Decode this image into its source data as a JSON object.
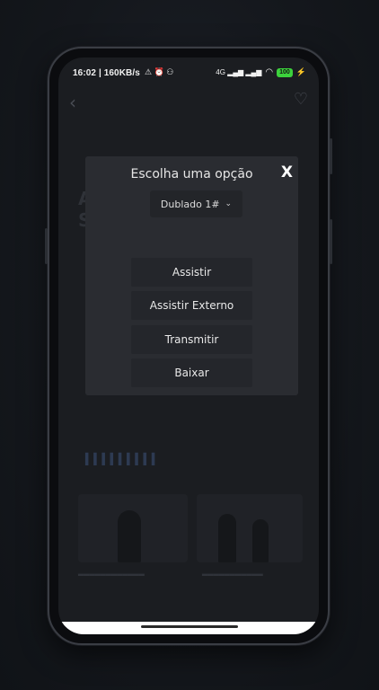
{
  "status_bar": {
    "time": "16:02 | 160KB/s",
    "indicators": "⚠ ⏰ ⚇",
    "network": "4G ▂▄▆ ▂▄▆",
    "battery": "100"
  },
  "dialog": {
    "title": "Escolha uma opção",
    "close_label": "X",
    "select_value": "Dublado 1#",
    "buttons": [
      "Assistir",
      "Assistir Externo",
      "Transmitir",
      "Baixar"
    ]
  },
  "colors": {
    "background": "#14171c",
    "dialog": "#2a2c31",
    "button": "#24262b",
    "battery": "#3cd23c"
  },
  "icons": [
    "back-arrow-icon",
    "heart-icon",
    "close-icon",
    "chevron-down-icon",
    "wifi-icon",
    "signal-icon",
    "battery-icon"
  ]
}
